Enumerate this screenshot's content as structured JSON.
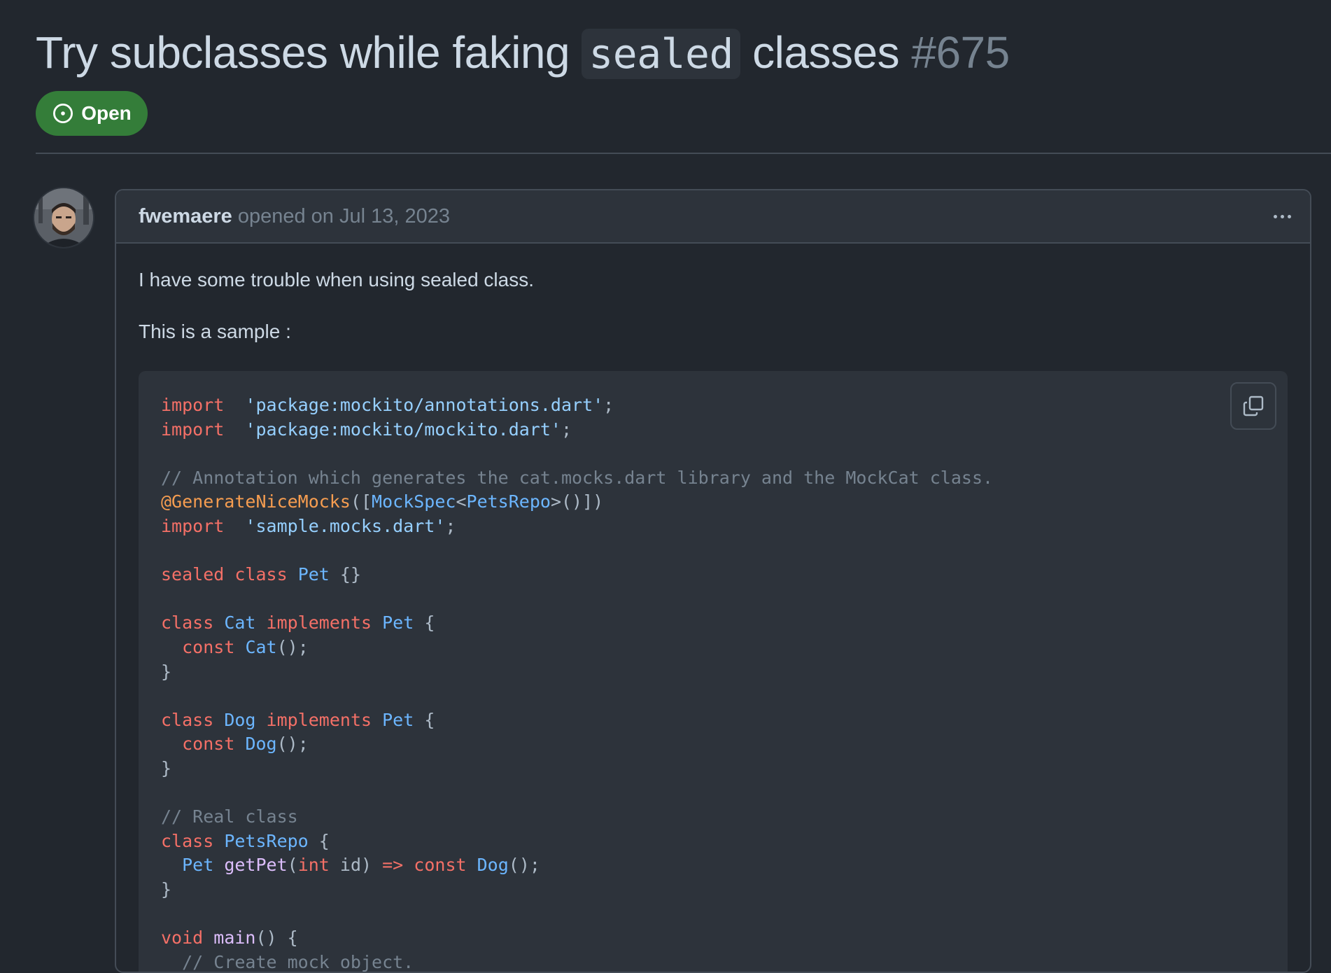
{
  "issue": {
    "title_before": "Try subclasses while faking ",
    "title_code": "sealed",
    "title_after": " classes ",
    "number": "#675",
    "state": "Open"
  },
  "comment": {
    "author": "fwemaere",
    "meta": "opened on Jul 13, 2023",
    "menu_icon": "kebab-horizontal-icon",
    "paragraphs": [
      "I have some trouble when using sealed class.",
      "This is a sample :"
    ],
    "copy_icon": "copy-icon",
    "code": [
      [
        [
          "kw",
          "import"
        ],
        [
          "",
          "  "
        ],
        [
          "st",
          "'package:mockito/annotations.dart'"
        ],
        [
          "",
          ";"
        ]
      ],
      [
        [
          "kw",
          "import"
        ],
        [
          "",
          "  "
        ],
        [
          "st",
          "'package:mockito/mockito.dart'"
        ],
        [
          "",
          ";"
        ]
      ],
      [],
      [
        [
          "cm",
          "// Annotation which generates the cat.mocks.dart library and the MockCat class."
        ]
      ],
      [
        [
          "an",
          "@GenerateNiceMocks"
        ],
        [
          "",
          "(["
        ],
        [
          "ty",
          "MockSpec"
        ],
        [
          "",
          "<"
        ],
        [
          "ty",
          "PetsRepo"
        ],
        [
          "",
          ">()])"
        ]
      ],
      [
        [
          "kw",
          "import"
        ],
        [
          "",
          "  "
        ],
        [
          "st",
          "'sample.mocks.dart'"
        ],
        [
          "",
          ";"
        ]
      ],
      [],
      [
        [
          "kw",
          "sealed"
        ],
        [
          "",
          " "
        ],
        [
          "kw",
          "class"
        ],
        [
          "",
          " "
        ],
        [
          "ty",
          "Pet"
        ],
        [
          "",
          " {}"
        ]
      ],
      [],
      [
        [
          "kw",
          "class"
        ],
        [
          "",
          " "
        ],
        [
          "ty",
          "Cat"
        ],
        [
          "",
          " "
        ],
        [
          "kw",
          "implements"
        ],
        [
          "",
          " "
        ],
        [
          "ty",
          "Pet"
        ],
        [
          "",
          " {"
        ]
      ],
      [
        [
          "",
          "  "
        ],
        [
          "kw",
          "const"
        ],
        [
          "",
          " "
        ],
        [
          "ty",
          "Cat"
        ],
        [
          "",
          "();"
        ]
      ],
      [
        [
          "",
          "}"
        ]
      ],
      [],
      [
        [
          "kw",
          "class"
        ],
        [
          "",
          " "
        ],
        [
          "ty",
          "Dog"
        ],
        [
          "",
          " "
        ],
        [
          "kw",
          "implements"
        ],
        [
          "",
          " "
        ],
        [
          "ty",
          "Pet"
        ],
        [
          "",
          " {"
        ]
      ],
      [
        [
          "",
          "  "
        ],
        [
          "kw",
          "const"
        ],
        [
          "",
          " "
        ],
        [
          "ty",
          "Dog"
        ],
        [
          "",
          "();"
        ]
      ],
      [
        [
          "",
          "}"
        ]
      ],
      [],
      [
        [
          "cm",
          "// Real class"
        ]
      ],
      [
        [
          "kw",
          "class"
        ],
        [
          "",
          " "
        ],
        [
          "ty",
          "PetsRepo"
        ],
        [
          "",
          " {"
        ]
      ],
      [
        [
          "",
          "  "
        ],
        [
          "ty",
          "Pet"
        ],
        [
          "",
          " "
        ],
        [
          "en",
          "getPet"
        ],
        [
          "",
          "("
        ],
        [
          "kw",
          "int"
        ],
        [
          "",
          " id) "
        ],
        [
          "kw",
          "=>"
        ],
        [
          "",
          " "
        ],
        [
          "kw",
          "const"
        ],
        [
          "",
          " "
        ],
        [
          "ty",
          "Dog"
        ],
        [
          "",
          "();"
        ]
      ],
      [
        [
          "",
          "}"
        ]
      ],
      [],
      [
        [
          "kw",
          "void"
        ],
        [
          "",
          " "
        ],
        [
          "en",
          "main"
        ],
        [
          "",
          "() {"
        ]
      ],
      [
        [
          "",
          "  "
        ],
        [
          "cm",
          "// Create mock object."
        ]
      ]
    ]
  }
}
